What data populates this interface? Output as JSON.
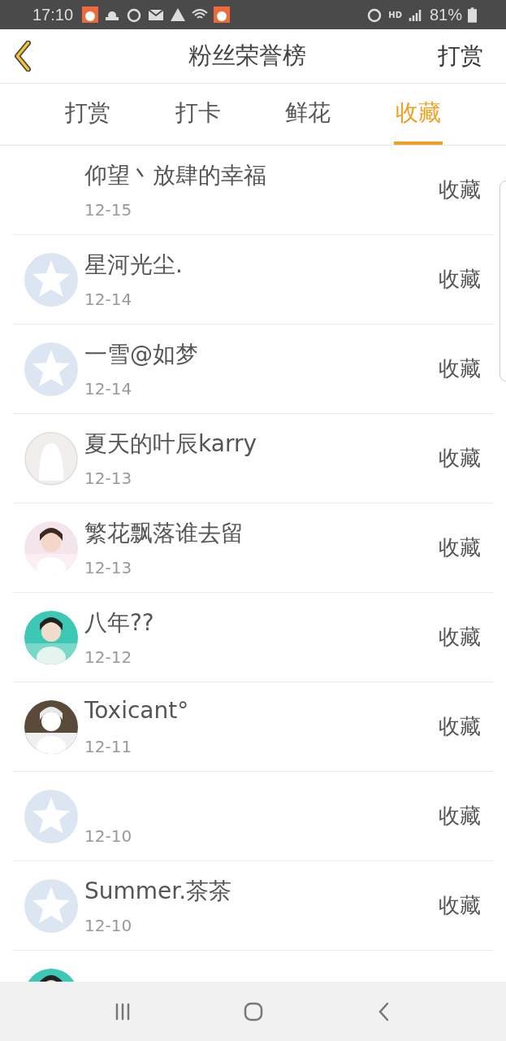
{
  "status_bar": {
    "time": "17:10",
    "network": "HD",
    "battery": "81%"
  },
  "header": {
    "title": "粉丝荣誉榜",
    "action": "打赏"
  },
  "tabs": [
    {
      "label": "打赏",
      "selected": false
    },
    {
      "label": "打卡",
      "selected": false
    },
    {
      "label": "鲜花",
      "selected": false
    },
    {
      "label": "收藏",
      "selected": true
    }
  ],
  "rows": [
    {
      "name": "仰望丶放肆的幸福",
      "date": "12-15",
      "type": "收藏"
    },
    {
      "kind": "default",
      "name": "星河光尘.",
      "date": "12-14",
      "type": "收藏"
    },
    {
      "kind": "default",
      "name": "一雪@如梦",
      "date": "12-14",
      "type": "收藏"
    },
    {
      "kind": "blank",
      "name": "夏天的叶辰karry",
      "date": "12-13",
      "type": "收藏"
    },
    {
      "kind": "picture",
      "name": "繁花飘落谁去留",
      "date": "12-13",
      "type": "收藏"
    },
    {
      "kind": "picture",
      "name": "八年??",
      "date": "12-12",
      "type": "收藏"
    },
    {
      "kind": "picture",
      "name": "Toxicant°",
      "date": "12-11",
      "type": "收藏"
    },
    {
      "kind": "default",
      "date": "12-10",
      "type": "收藏"
    },
    {
      "kind": "default",
      "name": "Summer.茶茶",
      "date": "12-10",
      "type": "收藏"
    },
    {
      "kind": "picture"
    }
  ]
}
